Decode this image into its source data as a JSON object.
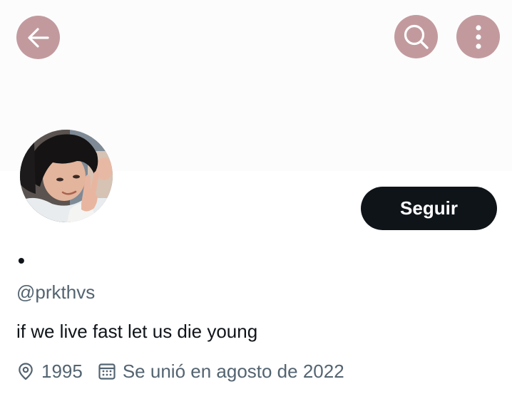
{
  "header": {
    "back_icon": "arrow-left-icon",
    "search_icon": "search-icon",
    "more_icon": "more-vertical-icon",
    "button_color": "#c29a9e"
  },
  "profile": {
    "display_name": "•",
    "handle": "@prkthvs",
    "bio": "if we live fast let us die young",
    "location": "1995",
    "location_icon": "location-pin-icon",
    "joined": "Se unió en agosto de 2022",
    "joined_icon": "calendar-icon"
  },
  "actions": {
    "follow_label": "Seguir",
    "follow_color": "#0f1419"
  }
}
